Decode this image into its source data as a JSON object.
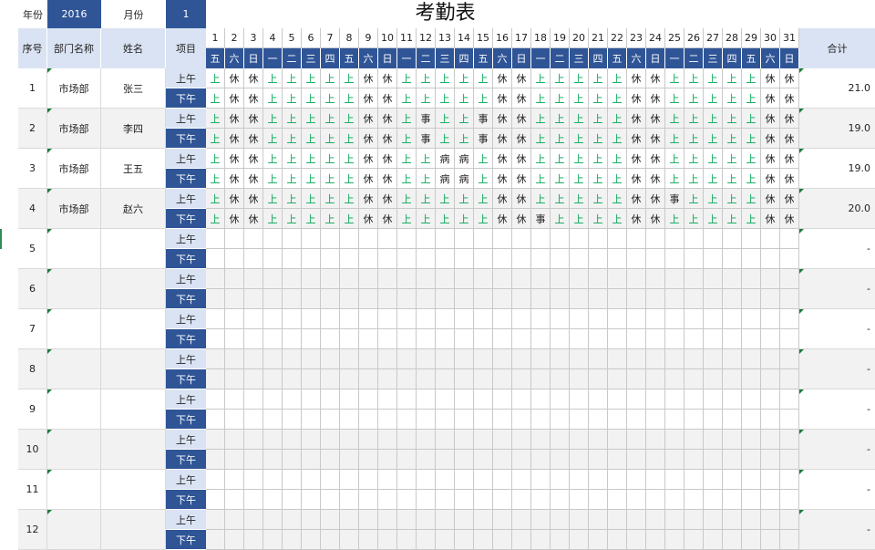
{
  "meta": {
    "year_label": "年份",
    "year": "2016",
    "month_label": "月份",
    "month": "1",
    "title": "考勤表"
  },
  "headers": {
    "seq": "序号",
    "dept": "部门名称",
    "name": "姓名",
    "item": "项目",
    "total": "合计"
  },
  "days": [
    "1",
    "2",
    "3",
    "4",
    "5",
    "6",
    "7",
    "8",
    "9",
    "10",
    "11",
    "12",
    "13",
    "14",
    "15",
    "16",
    "17",
    "18",
    "19",
    "20",
    "21",
    "22",
    "23",
    "24",
    "25",
    "26",
    "27",
    "28",
    "29",
    "30",
    "31"
  ],
  "weekdays": [
    "五",
    "六",
    "日",
    "一",
    "二",
    "三",
    "四",
    "五",
    "六",
    "日",
    "一",
    "二",
    "三",
    "四",
    "五",
    "六",
    "日",
    "一",
    "二",
    "三",
    "四",
    "五",
    "六",
    "日",
    "一",
    "二",
    "三",
    "四",
    "五",
    "六",
    "日"
  ],
  "periods": [
    "上午",
    "下午"
  ],
  "employees": [
    {
      "seq": "1",
      "dept": "市场部",
      "name": "张三",
      "total": "21.0",
      "am": [
        "上",
        "休",
        "休",
        "上",
        "上",
        "上",
        "上",
        "上",
        "休",
        "休",
        "上",
        "上",
        "上",
        "上",
        "上",
        "休",
        "休",
        "上",
        "上",
        "上",
        "上",
        "上",
        "休",
        "休",
        "上",
        "上",
        "上",
        "上",
        "上",
        "休",
        "休"
      ],
      "pm": [
        "上",
        "休",
        "休",
        "上",
        "上",
        "上",
        "上",
        "上",
        "休",
        "休",
        "上",
        "上",
        "上",
        "上",
        "上",
        "休",
        "休",
        "上",
        "上",
        "上",
        "上",
        "上",
        "休",
        "休",
        "上",
        "上",
        "上",
        "上",
        "上",
        "休",
        "休"
      ]
    },
    {
      "seq": "2",
      "dept": "市场部",
      "name": "李四",
      "total": "19.0",
      "am": [
        "上",
        "休",
        "休",
        "上",
        "上",
        "上",
        "上",
        "上",
        "休",
        "休",
        "上",
        "事",
        "上",
        "上",
        "事",
        "休",
        "休",
        "上",
        "上",
        "上",
        "上",
        "上",
        "休",
        "休",
        "上",
        "上",
        "上",
        "上",
        "上",
        "休",
        "休"
      ],
      "pm": [
        "上",
        "休",
        "休",
        "上",
        "上",
        "上",
        "上",
        "上",
        "休",
        "休",
        "上",
        "事",
        "上",
        "上",
        "事",
        "休",
        "休",
        "上",
        "上",
        "上",
        "上",
        "上",
        "休",
        "休",
        "上",
        "上",
        "上",
        "上",
        "上",
        "休",
        "休"
      ]
    },
    {
      "seq": "3",
      "dept": "市场部",
      "name": "王五",
      "total": "19.0",
      "am": [
        "上",
        "休",
        "休",
        "上",
        "上",
        "上",
        "上",
        "上",
        "休",
        "休",
        "上",
        "上",
        "病",
        "病",
        "上",
        "休",
        "休",
        "上",
        "上",
        "上",
        "上",
        "上",
        "休",
        "休",
        "上",
        "上",
        "上",
        "上",
        "上",
        "休",
        "休"
      ],
      "pm": [
        "上",
        "休",
        "休",
        "上",
        "上",
        "上",
        "上",
        "上",
        "休",
        "休",
        "上",
        "上",
        "病",
        "病",
        "上",
        "休",
        "休",
        "上",
        "上",
        "上",
        "上",
        "上",
        "休",
        "休",
        "上",
        "上",
        "上",
        "上",
        "上",
        "休",
        "休"
      ]
    },
    {
      "seq": "4",
      "dept": "市场部",
      "name": "赵六",
      "total": "20.0",
      "am": [
        "上",
        "休",
        "休",
        "上",
        "上",
        "上",
        "上",
        "上",
        "休",
        "休",
        "上",
        "上",
        "上",
        "上",
        "上",
        "休",
        "休",
        "上",
        "上",
        "上",
        "上",
        "上",
        "休",
        "休",
        "事",
        "上",
        "上",
        "上",
        "上",
        "休",
        "休"
      ],
      "pm": [
        "上",
        "休",
        "休",
        "上",
        "上",
        "上",
        "上",
        "上",
        "休",
        "休",
        "上",
        "上",
        "上",
        "上",
        "上",
        "休",
        "休",
        "事",
        "上",
        "上",
        "上",
        "上",
        "休",
        "休",
        "上",
        "上",
        "上",
        "上",
        "上",
        "休",
        "休"
      ]
    },
    {
      "seq": "5",
      "dept": "",
      "name": "",
      "total": "-",
      "am": [],
      "pm": []
    },
    {
      "seq": "6",
      "dept": "",
      "name": "",
      "total": "-",
      "am": [],
      "pm": []
    },
    {
      "seq": "7",
      "dept": "",
      "name": "",
      "total": "-",
      "am": [],
      "pm": []
    },
    {
      "seq": "8",
      "dept": "",
      "name": "",
      "total": "-",
      "am": [],
      "pm": []
    },
    {
      "seq": "9",
      "dept": "",
      "name": "",
      "total": "-",
      "am": [],
      "pm": []
    },
    {
      "seq": "10",
      "dept": "",
      "name": "",
      "total": "-",
      "am": [],
      "pm": []
    },
    {
      "seq": "11",
      "dept": "",
      "name": "",
      "total": "-",
      "am": [],
      "pm": []
    },
    {
      "seq": "12",
      "dept": "",
      "name": "",
      "total": "-",
      "am": [],
      "pm": []
    }
  ],
  "colors": {
    "dark_blue": "#2f5597",
    "light_blue": "#dae3f3",
    "work_green": "#00a651",
    "alt_row": "#f2f2f2"
  }
}
